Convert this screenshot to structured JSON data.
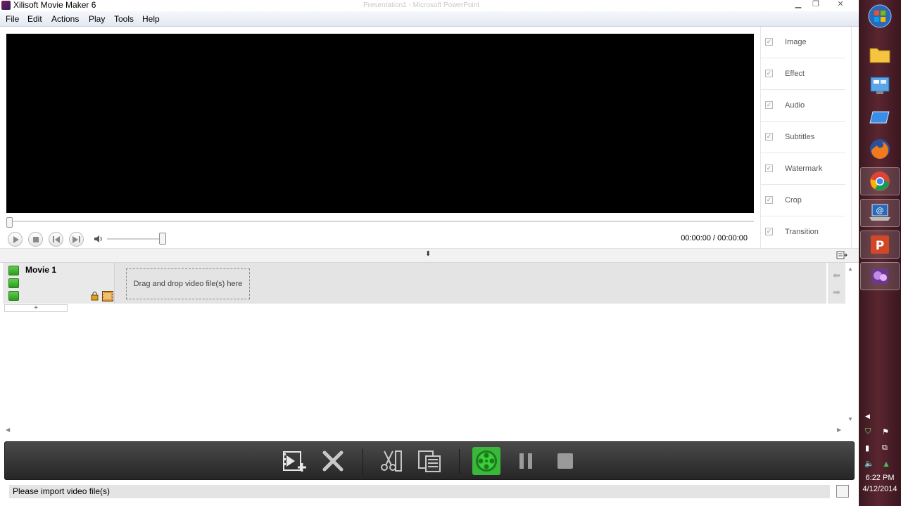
{
  "window": {
    "title": "Xilisoft Movie Maker 6",
    "background_title": "Presentation1 - Microsoft PowerPoint"
  },
  "menu": [
    "File",
    "Edit",
    "Actions",
    "Play",
    "Tools",
    "Help"
  ],
  "player": {
    "time": "00:00:00 / 00:00:00"
  },
  "right_panel": {
    "items": [
      "Image",
      "Effect",
      "Audio",
      "Subtitles",
      "Watermark",
      "Crop",
      "Transition"
    ]
  },
  "timeline": {
    "track_title": "Movie 1",
    "drop_hint": "Drag and drop video file(s) here",
    "add_track": "+"
  },
  "status": {
    "message": "Please import video file(s)"
  },
  "taskbar": {
    "time": "6:22 PM",
    "date": "4/12/2014"
  },
  "colors": {
    "accent_green": "#3ab83a",
    "toolbar_dark": "#2e2e2e"
  }
}
